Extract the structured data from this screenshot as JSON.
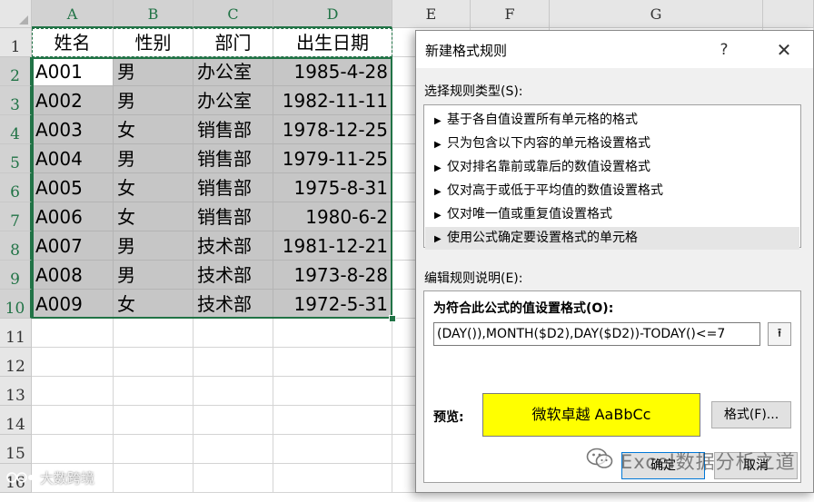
{
  "spreadsheet": {
    "columns": [
      "A",
      "B",
      "C",
      "D",
      "E",
      "F",
      "G"
    ],
    "rows": [
      "1",
      "2",
      "3",
      "4",
      "5",
      "6",
      "7",
      "8",
      "9",
      "10",
      "11",
      "12",
      "13",
      "14",
      "15",
      "16"
    ],
    "table": {
      "headers": [
        "姓名",
        "性别",
        "部门",
        "出生日期"
      ],
      "records": [
        [
          "A001",
          "男",
          "办公室",
          "1985-4-28"
        ],
        [
          "A002",
          "男",
          "办公室",
          "1982-11-11"
        ],
        [
          "A003",
          "女",
          "销售部",
          "1978-12-25"
        ],
        [
          "A004",
          "男",
          "销售部",
          "1979-11-25"
        ],
        [
          "A005",
          "女",
          "销售部",
          "1975-8-31"
        ],
        [
          "A006",
          "女",
          "销售部",
          "1980-6-2"
        ],
        [
          "A007",
          "男",
          "技术部",
          "1981-12-21"
        ],
        [
          "A008",
          "男",
          "技术部",
          "1973-8-28"
        ],
        [
          "A009",
          "女",
          "技术部",
          "1972-5-31"
        ]
      ]
    },
    "selection_color": "#217346"
  },
  "dialog": {
    "title": "新建格式规则",
    "help_label": "?",
    "close_label": "✕",
    "rule_type_label": "选择规则类型(S):",
    "rule_types": [
      "基于各自值设置所有单元格的格式",
      "只为包含以下内容的单元格设置格式",
      "仅对排名靠前或靠后的数值设置格式",
      "仅对高于或低于平均值的数值设置格式",
      "仅对唯一值或重复值设置格式",
      "使用公式确定要设置格式的单元格"
    ],
    "selected_rule_index": 5,
    "edit_label": "编辑规则说明(E):",
    "formula_label": "为符合此公式的值设置格式(O):",
    "formula_value": "DAY()),MONTH($D2),DAY($D2))-TODAY()<=7)",
    "preview_label": "预览:",
    "preview_text": "微软卓越  AaBbCc",
    "preview_color": "#ffff00",
    "format_button": "格式(F)...",
    "ok_button": "确定",
    "cancel_button": "取消"
  },
  "watermarks": {
    "right_text": "Excel数据分析之道",
    "left_text": "大数跨境"
  }
}
